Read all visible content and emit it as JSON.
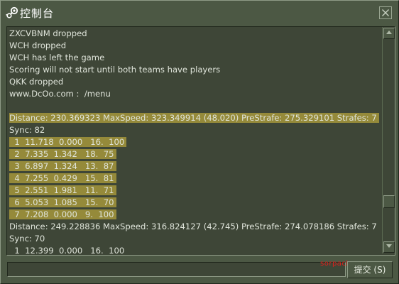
{
  "window": {
    "title": "控制台",
    "icon": "steam-icon",
    "close_icon": "close-icon"
  },
  "colors": {
    "background": "#4c5844",
    "panel": "#3e4637",
    "highlight": "#958a3a",
    "text": "#dfe4da",
    "watermark": "#e0201c"
  },
  "console": {
    "lines": [
      {
        "text": "ZXCVBNM dropped",
        "highlight": false
      },
      {
        "text": "WCH dropped",
        "highlight": false
      },
      {
        "text": "WCH has left the game",
        "highlight": false
      },
      {
        "text": "Scoring will not start until both teams have players",
        "highlight": false
      },
      {
        "text": "QKK dropped",
        "highlight": false
      },
      {
        "text": "www.DcOo.com :  /menu",
        "highlight": false
      },
      {
        "text": "",
        "highlight": false
      },
      {
        "text": "Distance: 230.369323 MaxSpeed: 323.349914 (48.020) PreStrafe: 275.329101 Strafes: 7",
        "highlight": true
      },
      {
        "text": "Sync: 82",
        "highlight": false
      },
      {
        "text": "  1  11.718  0.000   16.  100",
        "highlight": true
      },
      {
        "text": "  2  7.335  1.342   18.  75",
        "highlight": true
      },
      {
        "text": "  3  6.897  1.324   13.  87",
        "highlight": true
      },
      {
        "text": "  4  7.255  0.429   15.  81",
        "highlight": true
      },
      {
        "text": "  5  2.551  1.981   11.  71",
        "highlight": true
      },
      {
        "text": "  6  5.053  1.085   15.  70",
        "highlight": true
      },
      {
        "text": "  7  7.208  0.000   9.  100",
        "highlight": true
      },
      {
        "text": "Distance: 249.228836 MaxSpeed: 316.824127 (42.745) PreStrafe: 274.078186 Strafes: 7",
        "highlight": false
      },
      {
        "text": "Sync: 70",
        "highlight": false
      },
      {
        "text": "  1  12.399  0.000   16.  100",
        "highlight": false
      }
    ],
    "scroll_position": 0.82
  },
  "input": {
    "value": "",
    "placeholder": ""
  },
  "submit_button": {
    "label": "提交 (S)"
  },
  "watermark": {
    "text": "sorpack.com"
  }
}
